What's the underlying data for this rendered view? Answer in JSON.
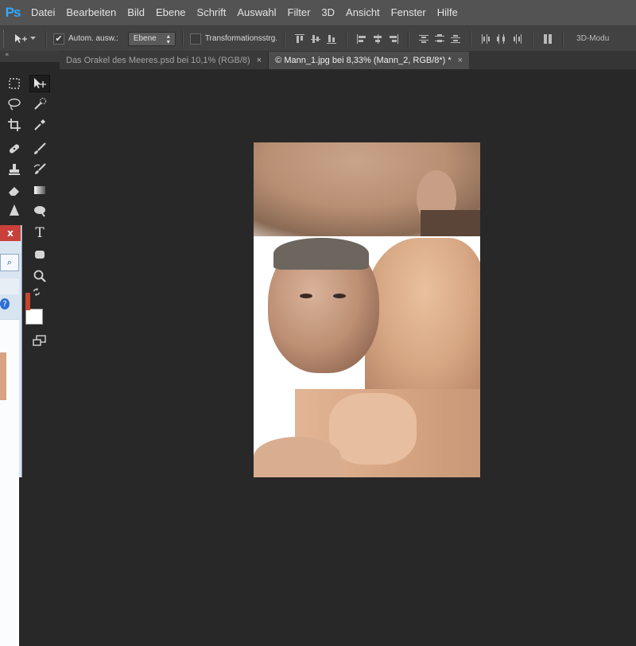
{
  "app": {
    "logo": "Ps"
  },
  "menu": [
    "Datei",
    "Bearbeiten",
    "Bild",
    "Ebene",
    "Schrift",
    "Auswahl",
    "Filter",
    "3D",
    "Ansicht",
    "Fenster",
    "Hilfe"
  ],
  "options": {
    "auto_select_label": "Autom. ausw.:",
    "auto_select_checked": true,
    "auto_select_value": "Ebene",
    "transform_label": "Transformationsstrg.",
    "transform_checked": false,
    "mode_3d_label": "3D-Modu"
  },
  "tabs": [
    {
      "label": "Das Orakel des Meeres.psd bei 10,1% (RGB/8)",
      "close": "×",
      "active": false
    },
    {
      "label": "© Mann_1.jpg bei 8,33% (Mann_2, RGB/8*) *",
      "close": "×",
      "active": true
    }
  ],
  "toolbar": {
    "collapse_glyph": "«",
    "type_tool_glyph": "T"
  },
  "left_window": {
    "close_glyph": "x",
    "search_glyph": "🔍",
    "help_glyph": "?"
  },
  "colors": {
    "menubar": "#535353",
    "optionsbar": "#424242",
    "workspace": "#282828",
    "accent_ps": "#31a8ff",
    "foreground_color": "#c7452f",
    "background_color": "#ffffff"
  }
}
